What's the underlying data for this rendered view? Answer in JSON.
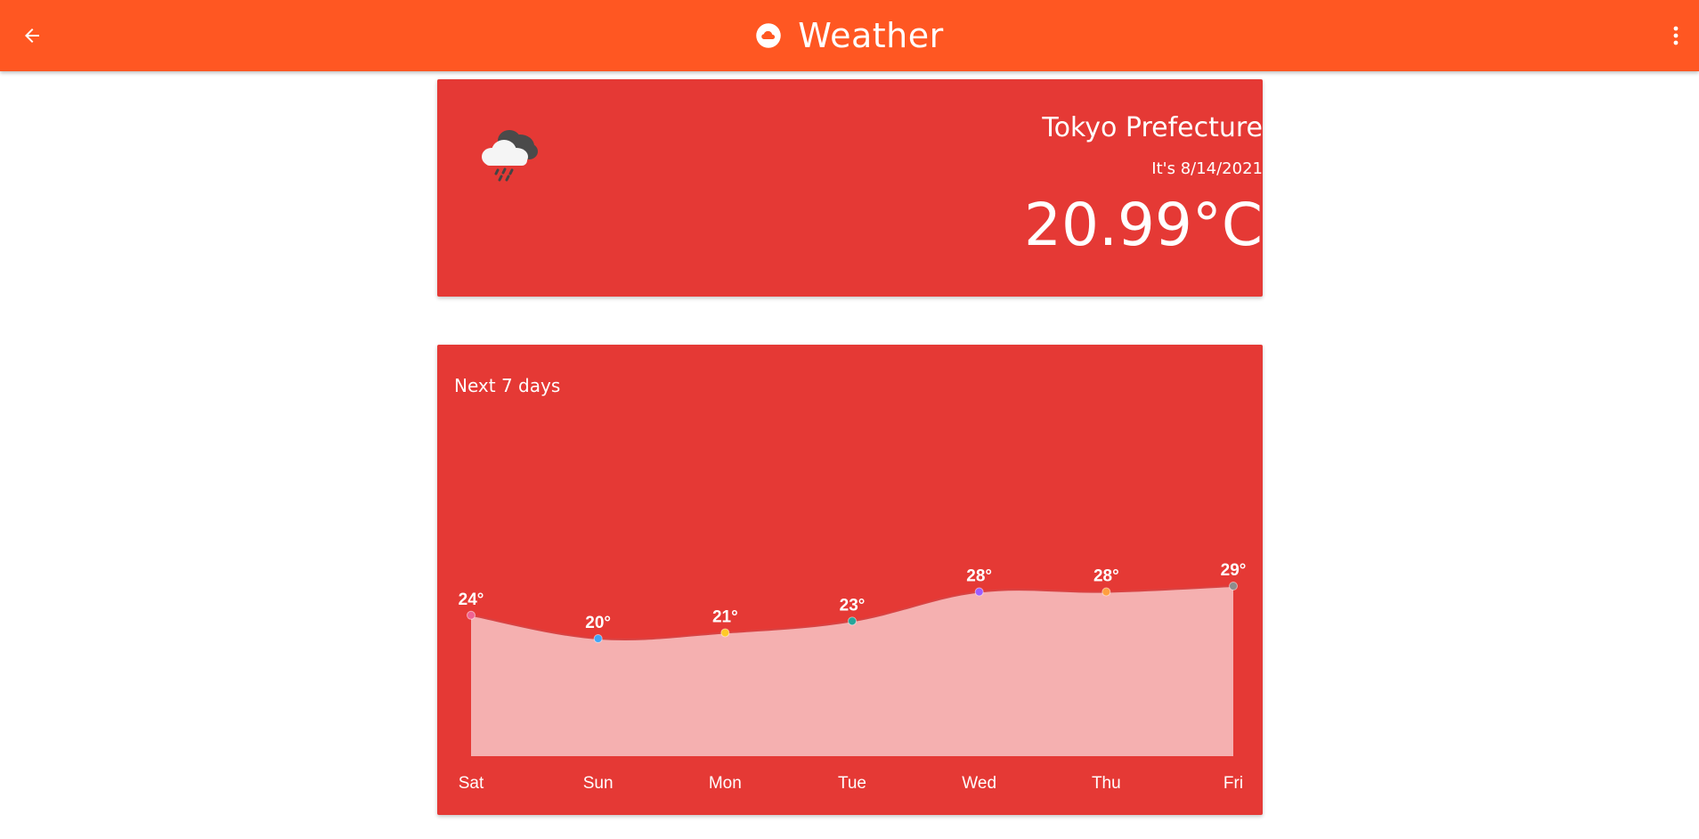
{
  "app_bar": {
    "title": "Weather",
    "back_icon": "arrow-back-icon",
    "app_icon": "cloud-icon",
    "menu_icon": "more-vert-icon"
  },
  "current": {
    "location": "Tokyo Prefecture",
    "date": "It's 8/14/2021",
    "temperature": "20.99°C",
    "condition_icon": "rain-cloud-icon"
  },
  "forecast": {
    "title": "Next 7 days"
  },
  "colors": {
    "app_bar": "#ff5722",
    "card": "#e53935",
    "area_fill": "#f5b0b0",
    "line": "#d84343"
  },
  "chart_data": {
    "type": "area",
    "categories": [
      "Sat",
      "Sun",
      "Mon",
      "Tue",
      "Wed",
      "Thu",
      "Fri"
    ],
    "series": [
      {
        "values": [
          24,
          20,
          21,
          23,
          28,
          28,
          29
        ],
        "labels": [
          "24°",
          "20°",
          "21°",
          "23°",
          "28°",
          "28°",
          "29°"
        ],
        "point_colors": [
          "#f06292",
          "#42a5f5",
          "#ffca28",
          "#26a69a",
          "#9c5cff",
          "#ff9f40",
          "#8d8d8d"
        ]
      }
    ],
    "grid": false,
    "legend": "none"
  }
}
